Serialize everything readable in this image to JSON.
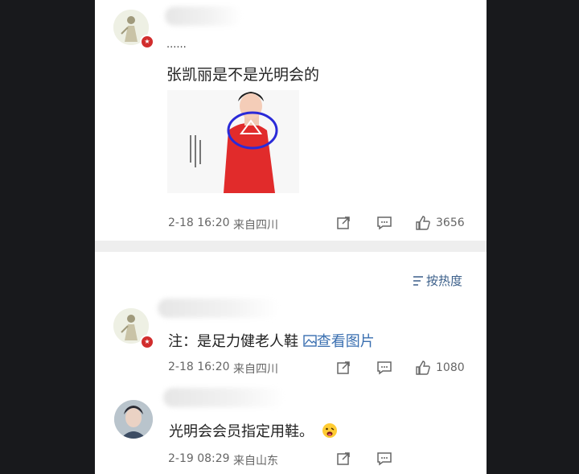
{
  "post": {
    "ellipsis": "......",
    "text": "张凯丽是不是光明会的",
    "time": "2-18 16:20",
    "location": "来自四川",
    "likes": "3656"
  },
  "sort": {
    "label": "按热度"
  },
  "comments": [
    {
      "text_prefix": "注：是足力健老人鞋",
      "link_label": "查看图片",
      "time": "2-18 16:20",
      "location": "来自四川",
      "likes": "1080"
    },
    {
      "text": "光明会会员指定用鞋。",
      "time": "2-19 08:29",
      "location": "来自山东"
    }
  ],
  "colors": {
    "background": "#18191c",
    "panel": "#ffffff",
    "link": "#3a6fb0",
    "meta": "#666666"
  },
  "icons": [
    "share-icon",
    "comment-icon",
    "like-icon",
    "image-link-icon",
    "sort-icon",
    "emoji-icon"
  ]
}
